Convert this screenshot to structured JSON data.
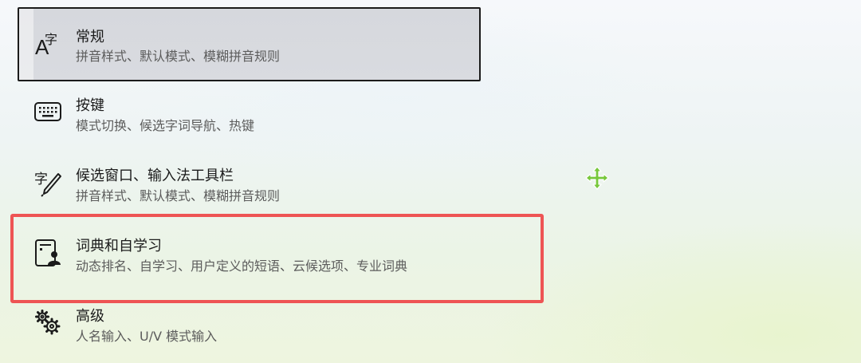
{
  "settings_list": {
    "items": [
      {
        "title": "常规",
        "description": "拼音样式、默认模式、模糊拼音规则",
        "icon": "font-character-icon",
        "selected": true
      },
      {
        "title": "按键",
        "description": "模式切换、候选字词导航、热键",
        "icon": "keyboard-icon",
        "selected": false
      },
      {
        "title": "候选窗口、输入法工具栏",
        "description": "拼音样式、默认模式、模糊拼音规则",
        "icon": "character-pen-icon",
        "selected": false
      },
      {
        "title": "词典和自学习",
        "description": "动态排名、自学习、用户定义的短语、云候选项、专业词典",
        "icon": "dictionary-user-icon",
        "selected": false,
        "highlighted": true
      },
      {
        "title": "高级",
        "description": "人名输入、U/V 模式输入",
        "icon": "gears-icon",
        "selected": false
      }
    ]
  },
  "annotation": {
    "highlight_color": "#ee5454",
    "cursor": "move-cursor-icon",
    "cursor_color": "#78c83c"
  },
  "icon_glyphs": {
    "general_char": "字",
    "general_latin": "A",
    "candidate_char": "字"
  }
}
